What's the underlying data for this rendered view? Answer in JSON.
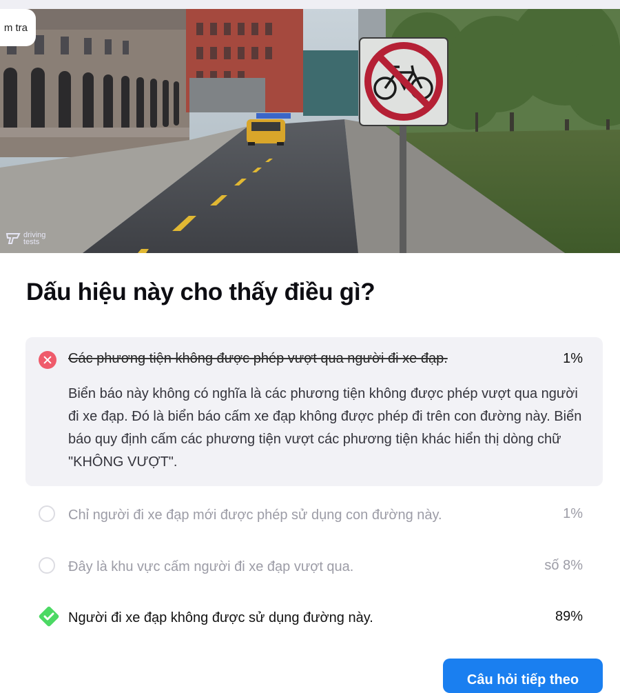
{
  "header": {
    "tab_label": "m tra"
  },
  "hero": {
    "watermark_line1": "driving",
    "watermark_line2": "tests",
    "image_desc_icon": "no-bicycle-sign-icon"
  },
  "question": {
    "title": "Dấu hiệu này cho thấy điều gì?"
  },
  "answers": [
    {
      "text": "Các phương tiện không được phép vượt qua người đi xe đạp.",
      "percent": "1%",
      "state": "wrong",
      "explanation": "Biển báo này không có nghĩa là các phương tiện không được phép vượt qua người đi xe đạp. Đó là biển báo cấm xe đạp không được phép đi trên con đường này. Biển báo quy định cấm các phương tiện vượt các phương tiện khác hiển thị dòng chữ \"KHÔNG VƯỢT\"."
    },
    {
      "text": "Chỉ người đi xe đạp mới được phép sử dụng con đường này.",
      "percent": "1%",
      "state": "unselected"
    },
    {
      "text": "Đây là khu vực cấm người đi xe đạp vượt qua.",
      "percent": "số 8%",
      "state": "unselected"
    },
    {
      "text": "Người đi xe đạp không được sử dụng đường này.",
      "percent": "89%",
      "state": "correct"
    }
  ],
  "footer": {
    "continue_label": "Câu hỏi tiếp theo"
  },
  "colors": {
    "wrong": "#ef5b6b",
    "correct": "#4cd964",
    "accent": "#1a7ff0"
  }
}
